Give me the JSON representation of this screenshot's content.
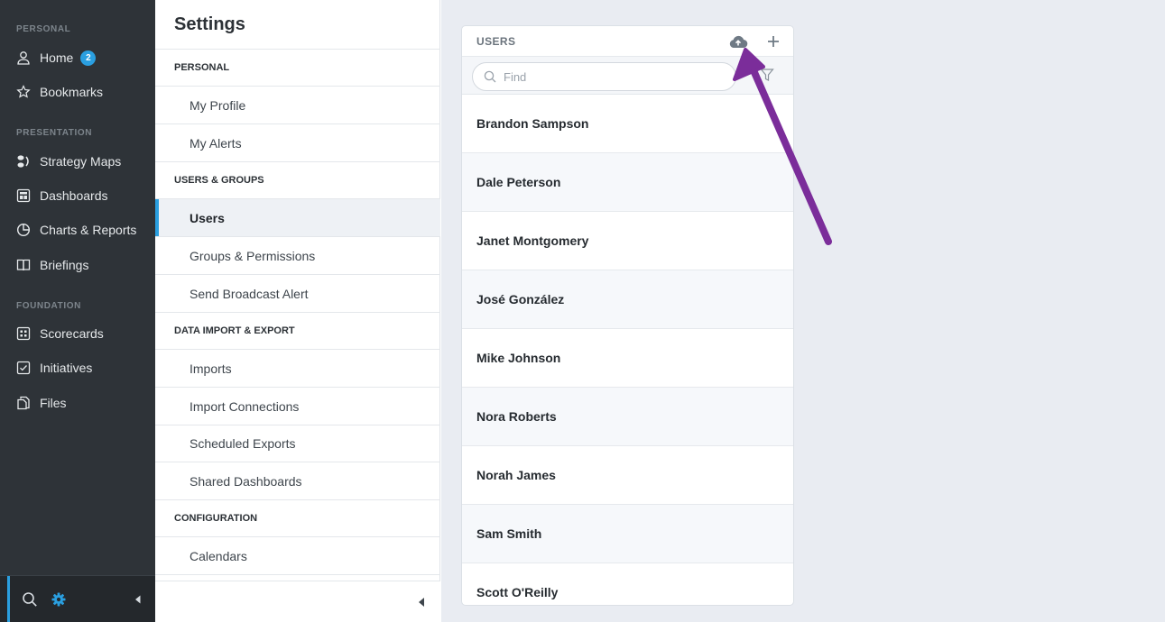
{
  "nav": {
    "sections": [
      "PERSONAL",
      "PRESENTATION",
      "FOUNDATION"
    ],
    "items": [
      {
        "label": "Home",
        "icon": "user-icon",
        "badge": "2"
      },
      {
        "label": "Bookmarks",
        "icon": "star-icon"
      },
      {
        "label": "Strategy Maps",
        "icon": "strategy-map-icon"
      },
      {
        "label": "Dashboards",
        "icon": "dashboard-icon"
      },
      {
        "label": "Charts & Reports",
        "icon": "pie-chart-icon"
      },
      {
        "label": "Briefings",
        "icon": "book-icon"
      },
      {
        "label": "Scorecards",
        "icon": "scorecard-icon"
      },
      {
        "label": "Initiatives",
        "icon": "checkbox-icon"
      },
      {
        "label": "Files",
        "icon": "file-icon"
      }
    ],
    "accent_color": "#2a9fe0"
  },
  "settings": {
    "title": "Settings",
    "sections": [
      "PERSONAL",
      "USERS & GROUPS",
      "DATA IMPORT & EXPORT",
      "CONFIGURATION"
    ],
    "items": [
      "My Profile",
      "My Alerts",
      "Users",
      "Groups & Permissions",
      "Send Broadcast Alert",
      "Imports",
      "Import Connections",
      "Scheduled Exports",
      "Shared Dashboards",
      "Calendars"
    ],
    "active_item": "Users"
  },
  "users_card": {
    "title": "USERS",
    "search_placeholder": "Find",
    "users": [
      "Brandon Sampson",
      "Dale Peterson",
      "Janet Montgomery",
      "José González",
      "Mike Johnson",
      "Nora Roberts",
      "Norah James",
      "Sam Smith",
      "Scott O'Reilly"
    ]
  },
  "annotation_color": "#7b2d9a"
}
